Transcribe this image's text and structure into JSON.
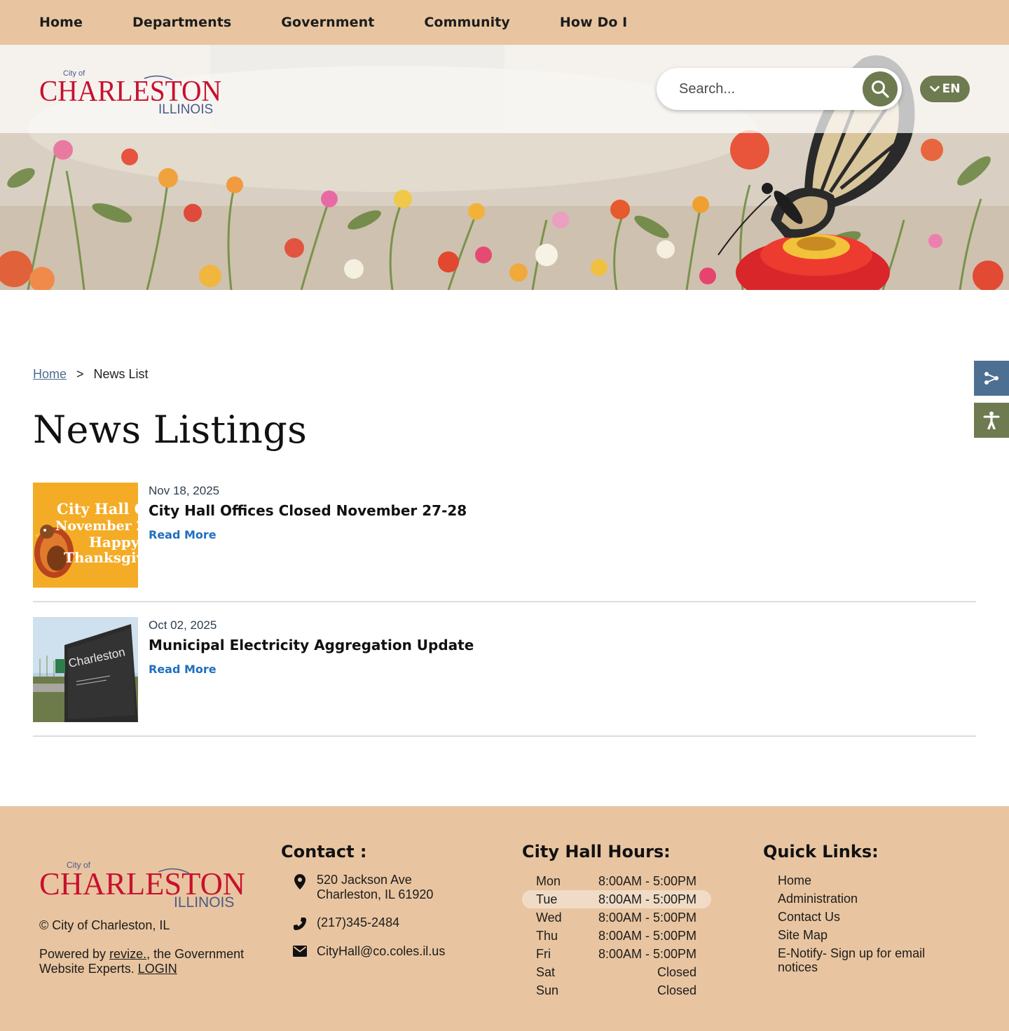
{
  "nav": {
    "items": [
      {
        "label": "Home"
      },
      {
        "label": "Departments"
      },
      {
        "label": "Government"
      },
      {
        "label": "Community"
      },
      {
        "label": "How Do I"
      }
    ]
  },
  "header": {
    "logo": {
      "small": "City of",
      "main": "CHARLESTON",
      "state": "ILLINOIS"
    },
    "search": {
      "placeholder": "Search..."
    },
    "language": {
      "label": "EN"
    }
  },
  "breadcrumb": {
    "home": "Home",
    "separator": ">",
    "current": "News List"
  },
  "page": {
    "title": "News Listings"
  },
  "news": [
    {
      "date": "Nov 18, 2025",
      "title": "City Hall Offices Closed November 27-28",
      "link": "Read More",
      "thumb_lines": [
        "City Hall Cl",
        "November 2",
        "Happy",
        "Thanksgiv"
      ]
    },
    {
      "date": "Oct 02, 2025",
      "title": "Municipal Electricity Aggregation Update",
      "link": "Read More",
      "thumb_sign": "Charleston"
    }
  ],
  "footer": {
    "logo": {
      "small": "City of",
      "main": "CHARLESTON",
      "state": "ILLINOIS"
    },
    "copyright": "© City of Charleston, IL",
    "powered": {
      "pre": "Powered by ",
      "brand": "revize.",
      "mid": ", the Government Website Experts. ",
      "login": "LOGIN"
    },
    "contact": {
      "heading": "Contact :",
      "address_line1": "520 Jackson Ave",
      "address_line2": "Charleston, IL 61920",
      "phone": "(217)345-2484",
      "email": "CityHall@co.coles.il.us"
    },
    "hours": {
      "heading": "City Hall Hours:",
      "rows": [
        {
          "day": "Mon",
          "time": "8:00AM - 5:00PM"
        },
        {
          "day": "Tue",
          "time": "8:00AM - 5:00PM"
        },
        {
          "day": "Wed",
          "time": "8:00AM - 5:00PM"
        },
        {
          "day": "Thu",
          "time": "8:00AM - 5:00PM"
        },
        {
          "day": "Fri",
          "time": "8:00AM - 5:00PM"
        },
        {
          "day": "Sat",
          "time": "Closed"
        },
        {
          "day": "Sun",
          "time": "Closed"
        }
      ],
      "highlighted_day": "Tue"
    },
    "quick_links": {
      "heading": "Quick Links:",
      "items": [
        {
          "label": "Home"
        },
        {
          "label": "Administration"
        },
        {
          "label": "Contact Us"
        },
        {
          "label": "Site Map"
        },
        {
          "label": "E-Notify- Sign up for email notices"
        }
      ]
    }
  },
  "icons": {
    "search": "search-icon",
    "language": "chevron-down-icon",
    "share": "share-icon",
    "accessibility": "accessibility-icon",
    "location": "location-pin-icon",
    "phone": "phone-icon",
    "email": "envelope-icon"
  },
  "colors": {
    "nav_bg": "#e8c5a0",
    "accent_green": "#6e7a4f",
    "share_blue": "#4d7092",
    "link_blue": "#1f6fbf",
    "logo_red": "#c8102e",
    "logo_blue": "#4a5a8a"
  }
}
